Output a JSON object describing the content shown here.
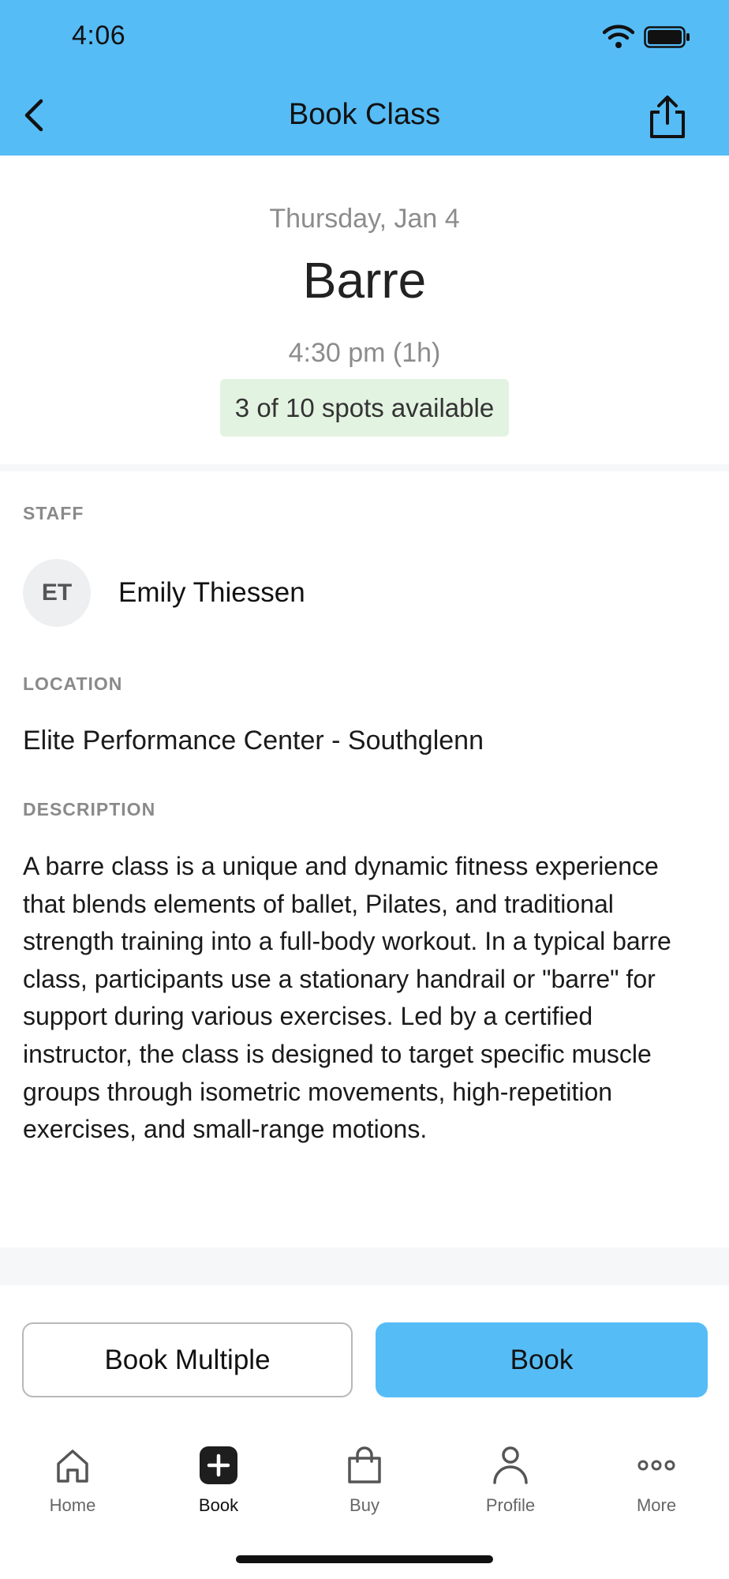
{
  "status_bar": {
    "time": "4:06"
  },
  "header": {
    "title": "Book Class"
  },
  "class": {
    "date": "Thursday, Jan 4",
    "name": "Barre",
    "time": "4:30 pm (1h)",
    "spots": "3 of 10 spots available"
  },
  "staff": {
    "label": "STAFF",
    "initials": "ET",
    "name": "Emily Thiessen"
  },
  "location": {
    "label": "LOCATION",
    "value": "Elite Performance Center - Southglenn"
  },
  "description": {
    "label": "DESCRIPTION",
    "text": "A barre class is a unique and dynamic fitness experience that blends elements of ballet, Pilates, and traditional strength training into a full-body workout. In a typical barre class, participants use a stationary handrail or \"barre\" for support during various exercises. Led by a certified instructor, the class is designed to target specific muscle groups through isometric movements, high-repetition exercises, and small-range motions."
  },
  "actions": {
    "book_multiple": "Book Multiple",
    "book": "Book"
  },
  "tabs": [
    {
      "label": "Home",
      "icon": "home-icon"
    },
    {
      "label": "Book",
      "icon": "book-plus-icon",
      "active": true
    },
    {
      "label": "Buy",
      "icon": "shopping-bag-icon"
    },
    {
      "label": "Profile",
      "icon": "person-icon"
    },
    {
      "label": "More",
      "icon": "ellipsis-icon"
    }
  ],
  "colors": {
    "accent": "#56bcf6",
    "spots_bg": "#e3f3e1"
  }
}
